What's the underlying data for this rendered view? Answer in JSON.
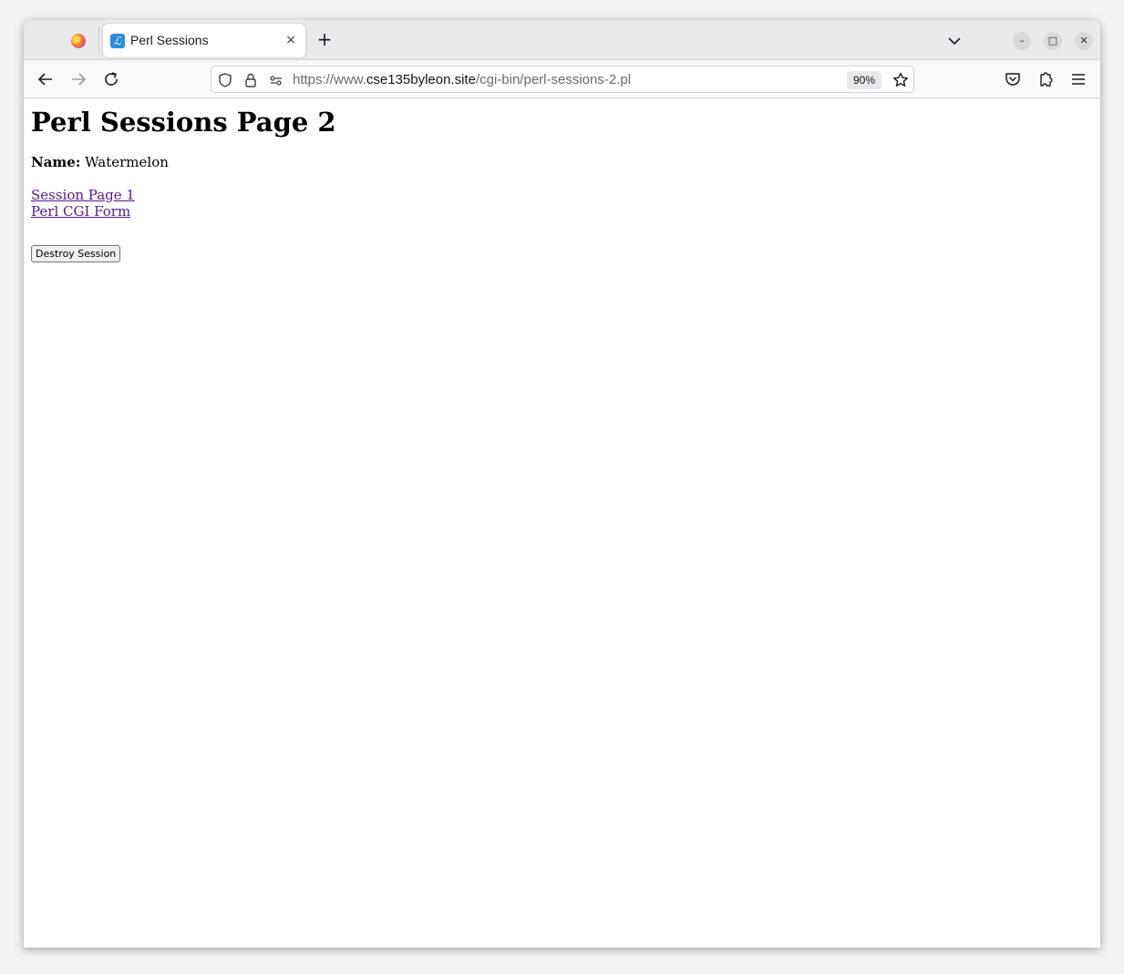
{
  "browser": {
    "tab": {
      "title": "Perl Sessions",
      "favicon_glyph": "ℒ",
      "close_glyph": "×"
    },
    "new_tab_glyph": "+",
    "window_controls": {
      "minimize": "–",
      "maximize": "□",
      "close": "✕"
    },
    "url": {
      "prefix": "https://www.",
      "host": "cse135byleon.site",
      "path": "/cgi-bin/perl-sessions-2.pl"
    },
    "zoom": "90%"
  },
  "page": {
    "heading": "Perl Sessions Page 2",
    "name_label": "Name:",
    "name_value": "Watermelon",
    "links": [
      "Session Page 1",
      "Perl CGI Form"
    ],
    "destroy_button": "Destroy Session"
  },
  "colors": {
    "link_visited": "#551a8b",
    "favicon_bg": "#2e8bd6"
  }
}
